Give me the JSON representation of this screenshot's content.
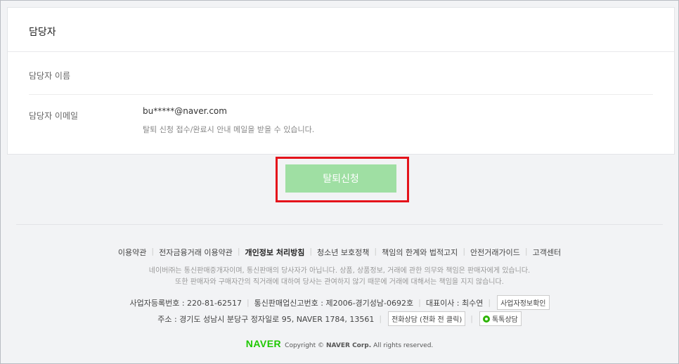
{
  "manager_card": {
    "title": "담당자",
    "name_label": "담당자 이름",
    "email_label": "담당자 이메일",
    "email_value": "bu*****@naver.com",
    "email_note": "탈퇴 신청 접수/완료시 안내 메일을 받을 수 있습니다."
  },
  "submit_button": {
    "label": "탈퇴신청",
    "color": "#9fdfa3",
    "highlight_color": "#e4131b"
  },
  "footer": {
    "links": [
      "이용약관",
      "전자금융거래 이용약관",
      "개인정보 처리방침",
      "청소년 보호정책",
      "책임의 한계와 법적고지",
      "안전거래가이드",
      "고객센터"
    ],
    "disclaimer_line1": "네이버㈜는 통신판매중개자이며, 통신판매의 당사자가 아닙니다. 상품, 상품정보, 거래에 관한 의무와 책임은 판매자에게 있습니다.",
    "disclaimer_line2": "또한 판매자와 구매자간의 직거래에 대하여 당사는 관여하지 않기 때문에 거래에 대해서는 책임을 지지 않습니다.",
    "business_reg": "사업자등록번호 : 220-81-62517",
    "mail_order_reg": "통신판매업신고번호 : 제2006-경기성남-0692호",
    "ceo": "대표이사 : 최수연",
    "business_info_button": "사업자정보확인",
    "address": "주소 : 경기도 성남시 분당구 정자일로 95, NAVER 1784, 13561",
    "phone_consult_button": "전화상담 (전화 전 클릭)",
    "talk_consult_button": "톡톡상담",
    "naver_logo": "NAVER",
    "copyright_prefix": "Copyright ©",
    "copyright_corp": "NAVER Corp.",
    "copyright_suffix": "All rights reserved.",
    "brand_color": "#1ec800"
  }
}
